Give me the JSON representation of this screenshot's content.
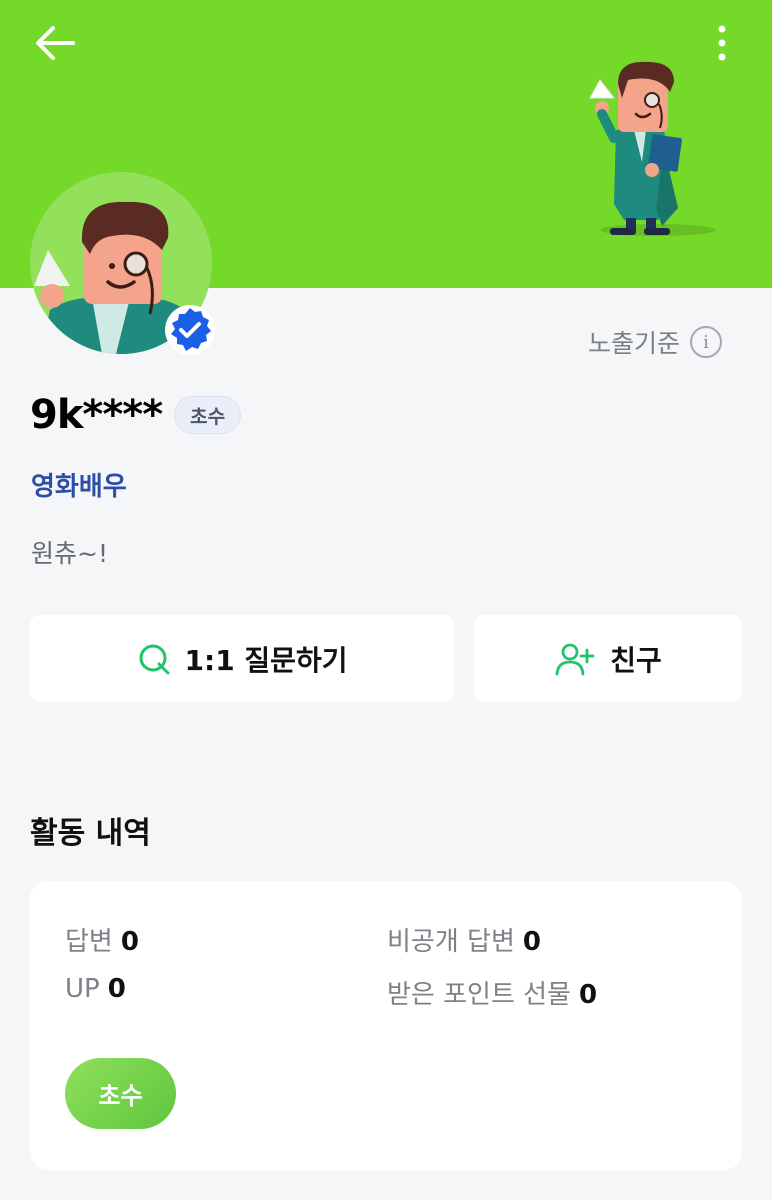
{
  "header": {
    "back_icon": "arrow-left-icon",
    "more_icon": "more-vertical-icon",
    "background_color": "#74d928"
  },
  "profile": {
    "verified_icon": "verified-check-icon",
    "exposure_label": "노출기준",
    "info_icon_glyph": "i",
    "nickname": "9k****",
    "grade": "초수",
    "title": "영화배우",
    "bio": "원츄~!"
  },
  "actions": {
    "question_label": "1:1 질문하기",
    "question_icon": "q-question-icon",
    "friend_label": "친구",
    "friend_icon": "add-friend-icon"
  },
  "activity": {
    "section_title": "활동 내역",
    "stats": [
      {
        "label": "답변",
        "value": "0"
      },
      {
        "label": "비공개 답변",
        "value": "0"
      },
      {
        "label": "UP",
        "value": "0"
      },
      {
        "label": "받은 포인트 선물",
        "value": "0"
      }
    ],
    "level_label": "초수"
  },
  "colors": {
    "accent_green": "#74d928",
    "link_blue": "#2c4ea6",
    "verified_blue": "#1a5fe6"
  }
}
